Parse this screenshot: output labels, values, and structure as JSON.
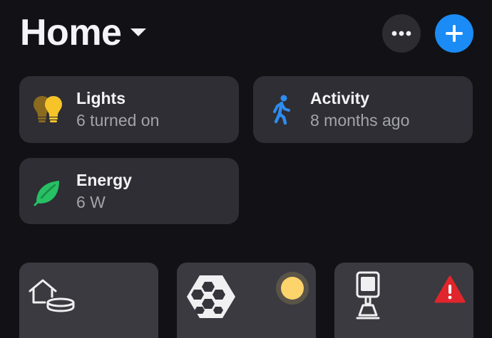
{
  "header": {
    "title": "Home",
    "title_caret_icon": "chevron-down-icon",
    "more_icon": "more-horizontal-icon",
    "add_icon": "plus-icon",
    "accent_color": "#1b8bf5"
  },
  "summary": {
    "tiles": [
      {
        "id": "lights",
        "icon": "lightbulbs-icon",
        "title": "Lights",
        "subtitle": "6 turned on"
      },
      {
        "id": "activity",
        "icon": "walking-person-icon",
        "title": "Activity",
        "subtitle": "8 months ago"
      },
      {
        "id": "energy",
        "icon": "leaf-icon",
        "title": "Energy",
        "subtitle": "6 W"
      }
    ]
  },
  "accessories": [
    {
      "icon": "home-hub-icon"
    },
    {
      "icon": "nanoleaf-hexagon-panels-icon",
      "status_icon": "light-on-icon"
    },
    {
      "icon": "motion-sensor-icon",
      "status_icon": "warning-icon",
      "status_color": "#e0262c"
    }
  ]
}
